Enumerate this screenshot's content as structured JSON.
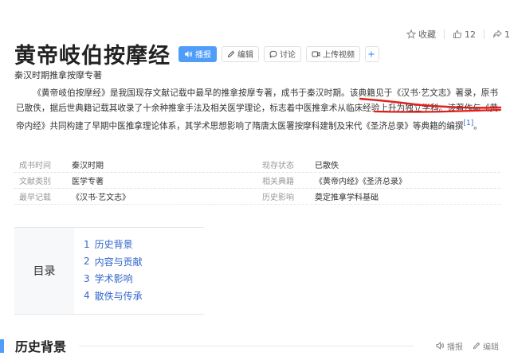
{
  "topbar": {
    "favorite_label": "收藏",
    "like_count": "12",
    "share_count": "1"
  },
  "header": {
    "title": "黄帝岐伯按摩经",
    "report_label": "播报",
    "edit_label": "编辑",
    "discuss_label": "讨论",
    "upload_video_label": "上传视频",
    "subtitle": "秦汉时期推拿按摩专著"
  },
  "summary": {
    "text": "《黄帝岐伯按摩经》是我国现存文献记载中最早的推拿按摩专著，成书于秦汉时期。该典籍见于《汉书·艺文志》著录，原书已散佚，据后世典籍记载其收录了十余种推拿手法及相关医学理论，标志着中医推拿术从临床经验上升为独立学科。该著作与《黄帝内经》共同构建了早期中医推拿理论体系，其学术思想影响了隋唐太医署按摩科建制及宋代《圣济总录》等典籍的编撰",
    "cite": "[1]",
    "end": "。"
  },
  "info": {
    "rows": [
      {
        "l1": "成书时间",
        "v1": "秦汉时期",
        "l2": "现存状态",
        "v2": "已散佚"
      },
      {
        "l1": "文献类别",
        "v1": "医学专著",
        "l2": "相关典籍",
        "v2": "《黄帝内经》《圣济总录》"
      },
      {
        "l1": "最早记载",
        "v1": "《汉书·艺文志》",
        "l2": "历史影响",
        "v2": "奠定推拿学科基础"
      }
    ]
  },
  "toc": {
    "label": "目录",
    "items": [
      {
        "num": "1",
        "label": "历史背景"
      },
      {
        "num": "2",
        "label": "内容与贡献"
      },
      {
        "num": "3",
        "label": "学术影响"
      },
      {
        "num": "4",
        "label": "散佚与传承"
      }
    ]
  },
  "section": {
    "title": "历史背景",
    "report_label": "播报",
    "edit_label": "编辑"
  },
  "colors": {
    "accent": "#4f9cf9",
    "link": "#3366cc",
    "annotation": "#e0201c"
  },
  "icons": [
    "star-icon",
    "thumb-up-icon",
    "share-icon",
    "speaker-icon",
    "pencil-icon",
    "chat-icon",
    "video-icon",
    "plus-icon"
  ]
}
